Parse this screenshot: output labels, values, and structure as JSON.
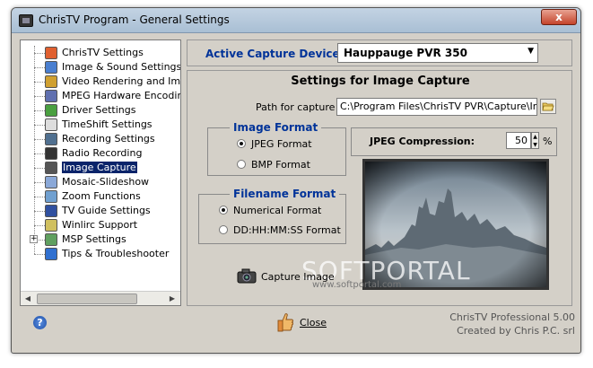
{
  "window": {
    "title": "ChrisTV Program - General Settings",
    "close_glyph": "x"
  },
  "tree": {
    "items": [
      {
        "label": "ChrisTV Settings",
        "icon": "settings-icon",
        "color": "#e06030"
      },
      {
        "label": "Image & Sound Settings",
        "icon": "image-sound-icon",
        "color": "#4a7fd0"
      },
      {
        "label": "Video Rendering and Improvements",
        "icon": "video-icon",
        "color": "#d0a030"
      },
      {
        "label": "MPEG Hardware Encoding",
        "icon": "mpeg-icon",
        "color": "#6070b0"
      },
      {
        "label": "Driver Settings",
        "icon": "driver-icon",
        "color": "#4aa040"
      },
      {
        "label": "TimeShift Settings",
        "icon": "clock-icon",
        "color": "#dddddd"
      },
      {
        "label": "Recording Settings",
        "icon": "recording-icon",
        "color": "#507090"
      },
      {
        "label": "Radio Recording",
        "icon": "microphone-icon",
        "color": "#333333"
      },
      {
        "label": "Image Capture",
        "icon": "camera-icon",
        "color": "#555555",
        "selected": true
      },
      {
        "label": "Mosaic-Slideshow",
        "icon": "mosaic-icon",
        "color": "#8aa8d8"
      },
      {
        "label": "Zoom Functions",
        "icon": "zoom-icon",
        "color": "#70a0d0"
      },
      {
        "label": "TV Guide Settings",
        "icon": "tv-guide-icon",
        "color": "#3050a0"
      },
      {
        "label": "Winlirc Support",
        "icon": "remote-icon",
        "color": "#d0c060"
      },
      {
        "label": "MSP Settings",
        "icon": "msp-icon",
        "color": "#60a060",
        "expander": "+"
      },
      {
        "label": "Tips & Troubleshooter",
        "icon": "tips-icon",
        "color": "#3070d0"
      }
    ]
  },
  "device": {
    "label": "Active Capture Device :",
    "value": "Hauppauge PVR 350"
  },
  "settings": {
    "title": "Settings for Image Capture",
    "path_label": "Path for capture",
    "path_value": "C:\\Program Files\\ChrisTV PVR\\Capture\\Imag",
    "image_format": {
      "title": "Image Format",
      "options": [
        "JPEG Format",
        "BMP Format"
      ],
      "selected": 0
    },
    "filename_format": {
      "title": "Filename Format",
      "options": [
        "Numerical Format",
        "DD:HH:MM:SS Format"
      ],
      "selected": 0
    },
    "jpeg": {
      "label": "JPEG Compression:",
      "value": "50",
      "unit": "%"
    },
    "capture_label": "Capture Image",
    "watermark": "SOFTPORTAL",
    "watermark_url": "www.softportal.com"
  },
  "footer": {
    "close_label": "Close",
    "version_line1": "ChrisTV Professional 5.00",
    "version_line2": "Created by Chris P.C. srl"
  }
}
